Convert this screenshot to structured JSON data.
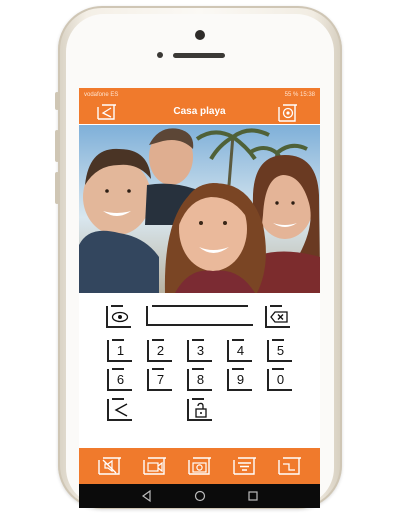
{
  "statusbar": {
    "carrier": "vodafone ES",
    "right": "55 % 15:38"
  },
  "appbar": {
    "title": "Casa playa",
    "back_icon": "back-arrow-icon",
    "settings_icon": "settings-gear-icon"
  },
  "keypad": {
    "keys": [
      "1",
      "2",
      "3",
      "4",
      "5",
      "6",
      "7",
      "8",
      "9",
      "0"
    ],
    "code_value": "",
    "show_icon": "eye-icon",
    "backspace_icon": "backspace-icon",
    "back_icon": "back-arrow-icon",
    "unlock_icon": "unlock-icon"
  },
  "bottombar": {
    "icons": [
      "mute-icon",
      "video-icon",
      "camera-icon",
      "menu-icon",
      "keypad-icon"
    ]
  },
  "navbar": {
    "icons": [
      "nav-back-icon",
      "nav-home-icon",
      "nav-recents-icon"
    ]
  },
  "colors": {
    "accent": "#f07a2c",
    "navbar": "#0b0b0b"
  }
}
